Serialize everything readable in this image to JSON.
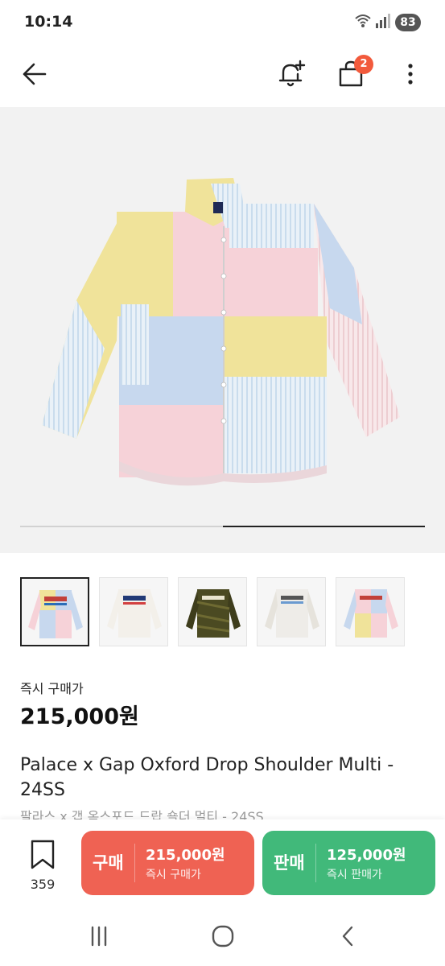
{
  "status": {
    "time": "10:14",
    "battery": "83"
  },
  "appbar": {
    "cart_count": "2"
  },
  "gallery": {
    "progress": 0.5,
    "thumbnail_count": 5,
    "active_index": 0
  },
  "product": {
    "price_label": "즉시 구매가",
    "price": "215,000원",
    "title": "Palace x Gap Oxford Drop Shoulder Multi - 24SS",
    "subtitle": "팔라스 x 갭 옥스포드 드랍 숄더 멀티 - 24SS"
  },
  "actions": {
    "wish_count": "359",
    "buy": {
      "label": "구매",
      "price": "215,000원",
      "sub": "즉시 구매가",
      "color": "#ef6253"
    },
    "sell": {
      "label": "판매",
      "price": "125,000원",
      "sub": "즉시 판매가",
      "color": "#41b97a"
    }
  },
  "icons": {
    "back": "arrow-left-icon",
    "bell": "bell-plus-icon",
    "bag": "shopping-bag-icon",
    "more": "more-vertical-icon",
    "wish": "bookmark-icon",
    "nav_recent": "recent-apps-icon",
    "nav_home": "home-icon",
    "nav_back": "nav-back-icon"
  }
}
